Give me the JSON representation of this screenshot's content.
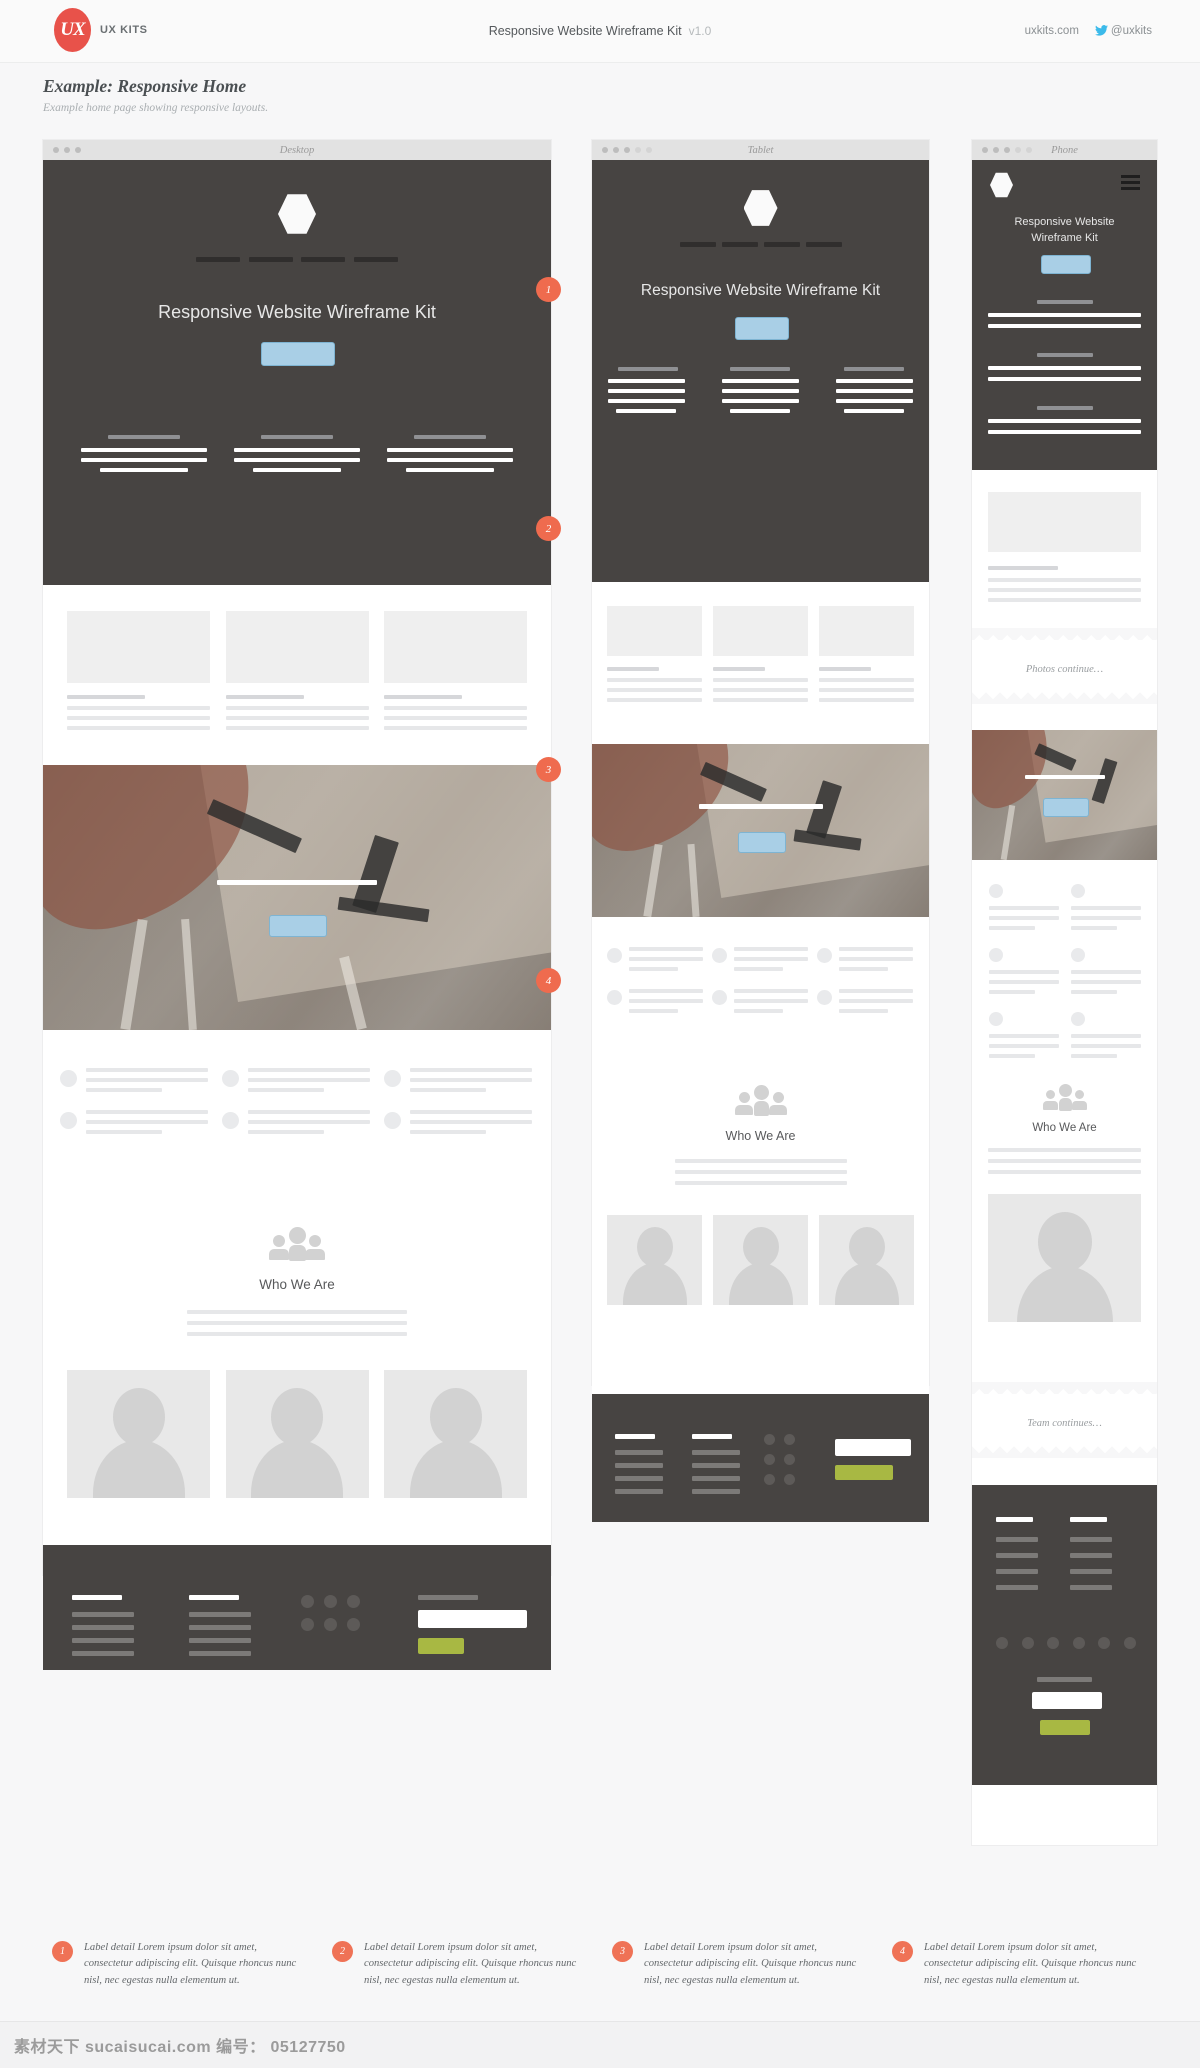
{
  "topbar": {
    "brand_mark": "UX",
    "brand_name": "UX KITS",
    "doc_title": "Responsive Website Wireframe Kit",
    "version": "v1.0",
    "website": "uxkits.com",
    "twitter_handle": "@uxkits"
  },
  "page": {
    "title": "Example: Responsive Home",
    "subtitle": "Example home page showing responsive layouts."
  },
  "frames": {
    "desktop": {
      "caption": "Desktop",
      "dots_on": 3,
      "dots_total": 3
    },
    "tablet": {
      "caption": "Tablet",
      "dots_on": 3,
      "dots_total": 5
    },
    "phone": {
      "caption": "Phone",
      "dots_on": 3,
      "dots_total": 5
    }
  },
  "hero": {
    "headline": "Responsive Website Wireframe Kit",
    "logo_icon": "hexagon-logo-icon",
    "cta_label": "",
    "nav_items": 4,
    "feature_columns": 3
  },
  "phone_hero": {
    "headline_line1": "Responsive Website",
    "headline_line2": "Wireframe Kit",
    "menu_icon": "hamburger-menu-icon",
    "feature_blocks": 3
  },
  "sections": {
    "photos_cards": 3,
    "photo_band_icon": "desk-photo",
    "features_rows": 2,
    "features_cols": 3,
    "team": {
      "icon": "people-group-icon",
      "heading": "Who We Are",
      "body_lines": 3,
      "members": 3
    },
    "footer": {
      "columns": 2,
      "social_dots": 6,
      "newsletter_input": "",
      "subscribe_label": ""
    }
  },
  "phone_notes": {
    "photos_continue": "Photos continue…",
    "team_continues": "Team continues…"
  },
  "markers": [
    {
      "num": "1"
    },
    {
      "num": "2"
    },
    {
      "num": "3"
    },
    {
      "num": "4"
    }
  ],
  "legend": [
    {
      "num": "1",
      "text": "Label detail Lorem ipsum dolor sit amet, consectetur adipiscing elit. Quisque rhoncus nunc nisl, nec egestas nulla elementum ut."
    },
    {
      "num": "2",
      "text": "Label detail Lorem ipsum dolor sit amet, consectetur adipiscing elit. Quisque rhoncus nunc nisl, nec egestas nulla elementum ut."
    },
    {
      "num": "3",
      "text": "Label detail Lorem ipsum dolor sit amet, consectetur adipiscing elit. Quisque rhoncus nunc nisl, nec egestas nulla elementum ut."
    },
    {
      "num": "4",
      "text": "Label detail Lorem ipsum dolor sit amet, consectetur adipiscing elit. Quisque rhoncus nunc nisl, nec egestas nulla elementum ut."
    }
  ],
  "watermark": {
    "text": "素材天下 sucaisucai.com  编号： 05127750"
  },
  "colors": {
    "accent_marker": "#ef6b4e",
    "brand_red": "#e8524a",
    "cta_blue": "#a9cfe6",
    "subscribe_green": "#a8b843",
    "dark_panel": "#474442",
    "page_bg": "#f7f7f8"
  }
}
